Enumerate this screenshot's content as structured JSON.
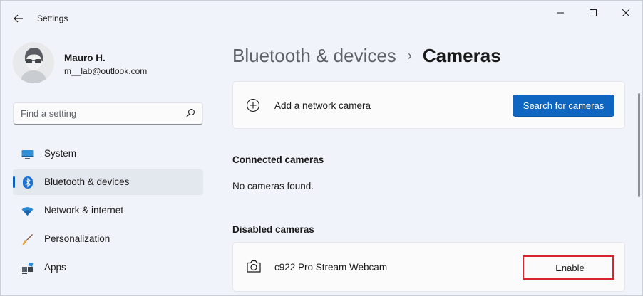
{
  "window": {
    "title": "Settings",
    "controls": {
      "minimize": "minimize-icon",
      "maximize": "maximize-icon",
      "close": "close-icon"
    }
  },
  "profile": {
    "name": "Mauro H.",
    "email": "m__lab@outlook.com"
  },
  "search": {
    "placeholder": "Find a setting",
    "value": ""
  },
  "nav": {
    "items": [
      {
        "label": "System",
        "icon": "monitor-icon",
        "active": false
      },
      {
        "label": "Bluetooth & devices",
        "icon": "bluetooth-icon",
        "active": true
      },
      {
        "label": "Network & internet",
        "icon": "wifi-icon",
        "active": false
      },
      {
        "label": "Personalization",
        "icon": "brush-icon",
        "active": false
      },
      {
        "label": "Apps",
        "icon": "apps-icon",
        "active": false
      }
    ]
  },
  "breadcrumb": {
    "parent": "Bluetooth & devices",
    "separator": "›",
    "current": "Cameras"
  },
  "add_camera": {
    "label": "Add a network camera",
    "button": "Search for cameras"
  },
  "connected": {
    "title": "Connected cameras",
    "empty_text": "No cameras found."
  },
  "disabled": {
    "title": "Disabled cameras",
    "cameras": [
      {
        "name": "c922 Pro Stream Webcam",
        "action": "Enable"
      }
    ]
  },
  "colors": {
    "accent": "#0f66c1",
    "highlight": "#d9232e",
    "background": "#f0f3f9"
  }
}
